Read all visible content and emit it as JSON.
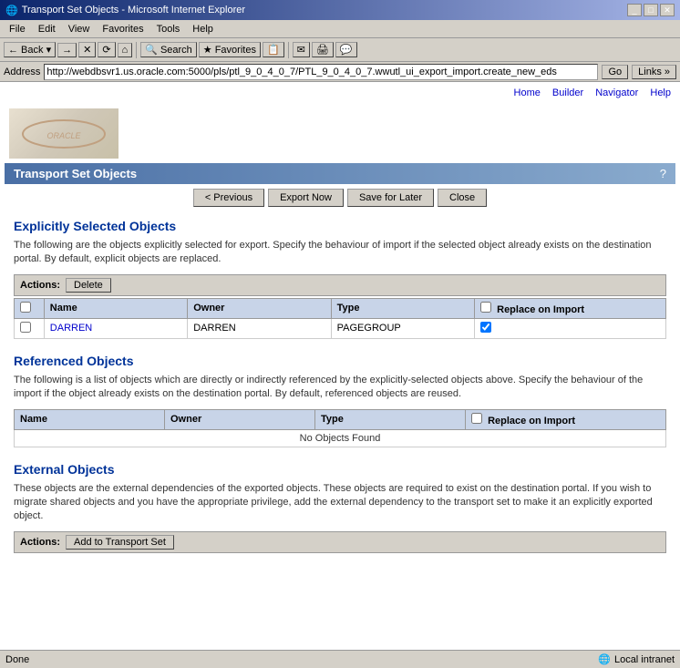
{
  "titleBar": {
    "title": "Transport Set Objects - Microsoft Internet Explorer",
    "controls": [
      "_",
      "□",
      "✕"
    ]
  },
  "menuBar": {
    "items": [
      "File",
      "Edit",
      "View",
      "Favorites",
      "Tools",
      "Help"
    ]
  },
  "toolbar": {
    "back": "← Back",
    "forward": "→",
    "stop": "✕",
    "refresh": "⟳",
    "home": "⌂",
    "search": "🔍",
    "favorites": "★",
    "history": "📋",
    "mail": "✉",
    "print": "🖨"
  },
  "addressBar": {
    "label": "Address",
    "url": "http://webdbsvr1.us.oracle.com:5000/pls/ptl_9_0_4_0_7/PTL_9_0_4_0_7.wwutl_ui_export_import.create_new_eds",
    "go": "Go",
    "links": "Links »"
  },
  "topNav": {
    "links": [
      "Home",
      "Builder",
      "Navigator",
      "Help"
    ]
  },
  "pageHeader": {
    "title": "Transport Set Objects",
    "help": "?"
  },
  "navButtons": {
    "previous": "< Previous",
    "exportNow": "Export Now",
    "saveForLater": "Save for Later",
    "close": "Close"
  },
  "explicitSection": {
    "title": "Explicitly Selected Objects",
    "description": "The following are the objects explicitly selected for export. Specify the behaviour of import if the selected object already exists on the destination portal. By default, explicit objects are replaced.",
    "actionsLabel": "Actions:",
    "deleteBtn": "Delete",
    "columns": {
      "checkbox": "",
      "name": "Name",
      "owner": "Owner",
      "type": "Type",
      "replaceOnImport": "Replace on Import"
    },
    "rows": [
      {
        "name": "DARREN",
        "owner": "DARREN",
        "type": "PAGEGROUP",
        "replaceChecked": true
      }
    ]
  },
  "referencedSection": {
    "title": "Referenced Objects",
    "description": "The following is a list of objects which are directly or indirectly referenced by the explicitly-selected objects above. Specify the behaviour of the import if the object already exists on the destination portal. By default, referenced objects are reused.",
    "columns": {
      "name": "Name",
      "owner": "Owner",
      "type": "Type",
      "replaceOnImport": "Replace on Import"
    },
    "noObjects": "No Objects Found"
  },
  "externalSection": {
    "title": "External Objects",
    "description": "These objects are the external dependencies of the exported objects. These objects are required to exist on the destination portal. If you wish to migrate shared objects and you have the appropriate privilege, add the external dependency to the transport set to make it an explicitly exported object.",
    "actionsLabel": "Actions:",
    "addBtn": "Add to Transport Set"
  },
  "statusBar": {
    "left": "Done",
    "right": "Local intranet"
  },
  "colors": {
    "headerBg": "#4a6fa5",
    "titleColor": "#003399",
    "tablHeader": "#c8d4e8",
    "linkColor": "#0000cc"
  }
}
